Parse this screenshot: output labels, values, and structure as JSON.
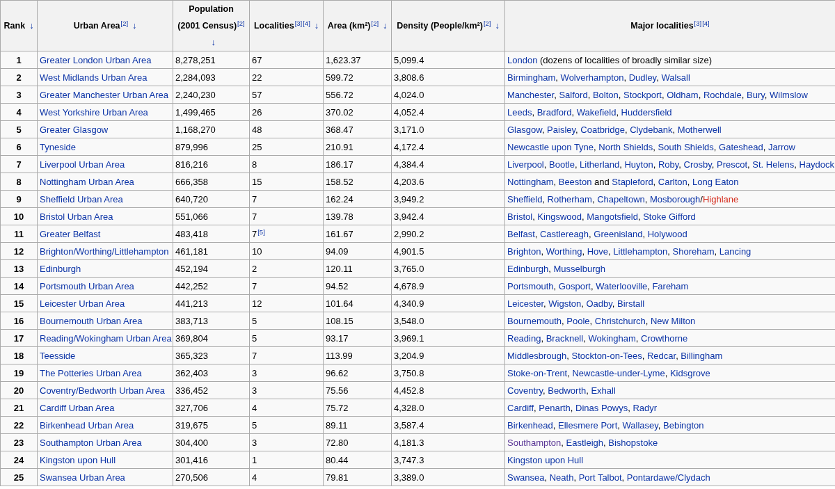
{
  "columns": [
    {
      "label": "Rank",
      "sort_icon": "↓",
      "kind": "sortable"
    },
    {
      "label": "Urban Area",
      "sort_icon": "↓",
      "refs": [
        "[2]"
      ],
      "kind": "sortable"
    },
    {
      "label": "Population",
      "label_2": "(2001 Census)",
      "sort_icon": "↓",
      "refs": [
        "[2]"
      ],
      "kind": "sortable"
    },
    {
      "label": "Localities",
      "sort_icon": "↓",
      "refs": [
        "[3]",
        "[4]"
      ],
      "kind": "sortable"
    },
    {
      "label": "Area (km²)",
      "sort_icon": "↓",
      "refs": [
        "[2]"
      ],
      "kind": "sortable"
    },
    {
      "label": "Density (People/km²)",
      "sort_icon": "↓",
      "refs": [
        "[2]"
      ],
      "kind": "sortable"
    },
    {
      "label": "Major localities",
      "refs": [
        "[3]",
        "[4]"
      ],
      "kind": "plain"
    }
  ],
  "rows": [
    {
      "rank": "1",
      "urban_area": "Greater London Urban Area",
      "population": "8,278,251",
      "localities": "67",
      "area": "1,623.37",
      "density": "5,099.4",
      "major": [
        {
          "text": "London",
          "kind": "link",
          "after": " (dozens of localities of broadly similar size)"
        }
      ]
    },
    {
      "rank": "2",
      "urban_area": "West Midlands Urban Area",
      "population": "2,284,093",
      "localities": "22",
      "area": "599.72",
      "density": "3,808.6",
      "major": [
        {
          "text": "Birmingham",
          "kind": "link",
          "after": ", "
        },
        {
          "text": "Wolverhampton",
          "kind": "link",
          "after": ", "
        },
        {
          "text": "Dudley",
          "kind": "link",
          "after": ", "
        },
        {
          "text": "Walsall",
          "kind": "link"
        }
      ]
    },
    {
      "rank": "3",
      "urban_area": "Greater Manchester Urban Area",
      "population": "2,240,230",
      "localities": "57",
      "area": "556.72",
      "density": "4,024.0",
      "major": [
        {
          "text": "Manchester",
          "kind": "link",
          "after": ", "
        },
        {
          "text": "Salford",
          "kind": "link",
          "after": ", "
        },
        {
          "text": "Bolton",
          "kind": "link",
          "after": ", "
        },
        {
          "text": "Stockport",
          "kind": "link",
          "after": ", "
        },
        {
          "text": "Oldham",
          "kind": "link",
          "after": ", "
        },
        {
          "text": "Rochdale",
          "kind": "link",
          "after": ", "
        },
        {
          "text": "Bury",
          "kind": "link",
          "after": ", "
        },
        {
          "text": "Wilmslow",
          "kind": "link"
        }
      ]
    },
    {
      "rank": "4",
      "urban_area": "West Yorkshire Urban Area",
      "population": "1,499,465",
      "localities": "26",
      "area": "370.02",
      "density": "4,052.4",
      "major": [
        {
          "text": "Leeds",
          "kind": "link",
          "after": ", "
        },
        {
          "text": "Bradford",
          "kind": "link",
          "after": ", "
        },
        {
          "text": "Wakefield",
          "kind": "link",
          "after": ", "
        },
        {
          "text": "Huddersfield",
          "kind": "link"
        }
      ]
    },
    {
      "rank": "5",
      "urban_area": "Greater Glasgow",
      "population": "1,168,270",
      "localities": "48",
      "area": "368.47",
      "density": "3,171.0",
      "major": [
        {
          "text": "Glasgow",
          "kind": "link",
          "after": ", "
        },
        {
          "text": "Paisley",
          "kind": "link",
          "after": ", "
        },
        {
          "text": "Coatbridge",
          "kind": "link",
          "after": ", "
        },
        {
          "text": "Clydebank",
          "kind": "link",
          "after": ", "
        },
        {
          "text": "Motherwell",
          "kind": "link"
        }
      ]
    },
    {
      "rank": "6",
      "urban_area": "Tyneside",
      "population": "879,996",
      "localities": "25",
      "area": "210.91",
      "density": "4,172.4",
      "major": [
        {
          "text": "Newcastle upon Tyne",
          "kind": "link",
          "after": ", "
        },
        {
          "text": "North Shields",
          "kind": "link",
          "after": ", "
        },
        {
          "text": "South Shields",
          "kind": "link",
          "after": ", "
        },
        {
          "text": "Gateshead",
          "kind": "link",
          "after": ", "
        },
        {
          "text": "Jarrow",
          "kind": "link"
        }
      ]
    },
    {
      "rank": "7",
      "urban_area": "Liverpool Urban Area",
      "population": "816,216",
      "localities": "8",
      "area": "186.17",
      "density": "4,384.4",
      "major": [
        {
          "text": "Liverpool",
          "kind": "link",
          "after": ", "
        },
        {
          "text": "Bootle",
          "kind": "link",
          "after": ", "
        },
        {
          "text": "Litherland",
          "kind": "link",
          "after": ", "
        },
        {
          "text": "Huyton",
          "kind": "link",
          "after": ", "
        },
        {
          "text": "Roby",
          "kind": "link",
          "after": ", "
        },
        {
          "text": "Crosby",
          "kind": "link",
          "after": ", "
        },
        {
          "text": "Prescot",
          "kind": "link",
          "after": ", "
        },
        {
          "text": "St. Helens",
          "kind": "link",
          "after": ", "
        },
        {
          "text": "Haydock",
          "kind": "link"
        }
      ]
    },
    {
      "rank": "8",
      "urban_area": "Nottingham Urban Area",
      "population": "666,358",
      "localities": "15",
      "area": "158.52",
      "density": "4,203.6",
      "major": [
        {
          "text": "Nottingham",
          "kind": "link",
          "after": ", "
        },
        {
          "text": "Beeston",
          "kind": "link",
          "after": " and "
        },
        {
          "text": "Stapleford",
          "kind": "link",
          "after": ", "
        },
        {
          "text": "Carlton",
          "kind": "link",
          "after": ", "
        },
        {
          "text": "Long Eaton",
          "kind": "link"
        }
      ]
    },
    {
      "rank": "9",
      "urban_area": "Sheffield Urban Area",
      "population": "640,720",
      "localities": "7",
      "area": "162.24",
      "density": "3,949.2",
      "major": [
        {
          "text": "Sheffield",
          "kind": "link",
          "after": ", "
        },
        {
          "text": "Rotherham",
          "kind": "link",
          "after": ", "
        },
        {
          "text": "Chapeltown",
          "kind": "link",
          "after": ", "
        },
        {
          "text": "Mosborough",
          "kind": "link",
          "after": "/"
        },
        {
          "text": "Highlane",
          "kind": "redlink"
        }
      ]
    },
    {
      "rank": "10",
      "urban_area": "Bristol Urban Area",
      "population": "551,066",
      "localities": "7",
      "area": "139.78",
      "density": "3,942.4",
      "major": [
        {
          "text": "Bristol",
          "kind": "link",
          "after": ", "
        },
        {
          "text": "Kingswood",
          "kind": "link",
          "after": ", "
        },
        {
          "text": "Mangotsfield",
          "kind": "link",
          "after": ", "
        },
        {
          "text": "Stoke Gifford",
          "kind": "link"
        }
      ]
    },
    {
      "rank": "11",
      "urban_area": "Greater Belfast",
      "population": "483,418",
      "localities": "7",
      "localities_ref": "[5]",
      "area": "161.67",
      "density": "2,990.2",
      "major": [
        {
          "text": "Belfast",
          "kind": "link",
          "after": ", "
        },
        {
          "text": "Castlereagh",
          "kind": "link",
          "after": ", "
        },
        {
          "text": "Greenisland",
          "kind": "link",
          "after": ", "
        },
        {
          "text": "Holywood",
          "kind": "link"
        }
      ]
    },
    {
      "rank": "12",
      "urban_area": "Brighton/Worthing/Littlehampton",
      "population": "461,181",
      "localities": "10",
      "area": "94.09",
      "density": "4,901.5",
      "major": [
        {
          "text": "Brighton",
          "kind": "link",
          "after": ", "
        },
        {
          "text": "Worthing",
          "kind": "link",
          "after": ", "
        },
        {
          "text": "Hove",
          "kind": "link",
          "after": ", "
        },
        {
          "text": "Littlehampton",
          "kind": "link",
          "after": ", "
        },
        {
          "text": "Shoreham",
          "kind": "link",
          "after": ", "
        },
        {
          "text": "Lancing",
          "kind": "link"
        }
      ]
    },
    {
      "rank": "13",
      "urban_area": "Edinburgh",
      "population": "452,194",
      "localities": "2",
      "area": "120.11",
      "density": "3,765.0",
      "major": [
        {
          "text": "Edinburgh",
          "kind": "link",
          "after": ", "
        },
        {
          "text": "Musselburgh",
          "kind": "link"
        }
      ]
    },
    {
      "rank": "14",
      "urban_area": "Portsmouth Urban Area",
      "population": "442,252",
      "localities": "7",
      "area": "94.52",
      "density": "4,678.9",
      "major": [
        {
          "text": "Portsmouth",
          "kind": "link",
          "after": ", "
        },
        {
          "text": "Gosport",
          "kind": "link",
          "after": ", "
        },
        {
          "text": "Waterlooville",
          "kind": "link",
          "after": ", "
        },
        {
          "text": "Fareham",
          "kind": "link"
        }
      ]
    },
    {
      "rank": "15",
      "urban_area": "Leicester Urban Area",
      "population": "441,213",
      "localities": "12",
      "area": "101.64",
      "density": "4,340.9",
      "major": [
        {
          "text": "Leicester",
          "kind": "link",
          "after": ", "
        },
        {
          "text": "Wigston",
          "kind": "link",
          "after": ", "
        },
        {
          "text": "Oadby",
          "kind": "link",
          "after": ", "
        },
        {
          "text": "Birstall",
          "kind": "link"
        }
      ]
    },
    {
      "rank": "16",
      "urban_area": "Bournemouth Urban Area",
      "population": "383,713",
      "localities": "5",
      "area": "108.15",
      "density": "3,548.0",
      "major": [
        {
          "text": "Bournemouth",
          "kind": "link",
          "after": ", "
        },
        {
          "text": "Poole",
          "kind": "link",
          "after": ", "
        },
        {
          "text": "Christchurch",
          "kind": "link",
          "after": ", "
        },
        {
          "text": "New Milton",
          "kind": "link"
        }
      ]
    },
    {
      "rank": "17",
      "urban_area": "Reading/Wokingham Urban Area",
      "population": "369,804",
      "localities": "5",
      "area": "93.17",
      "density": "3,969.1",
      "major": [
        {
          "text": "Reading",
          "kind": "link",
          "after": ", "
        },
        {
          "text": "Bracknell",
          "kind": "link",
          "after": ", "
        },
        {
          "text": "Wokingham",
          "kind": "link",
          "after": ", "
        },
        {
          "text": "Crowthorne",
          "kind": "link"
        }
      ]
    },
    {
      "rank": "18",
      "urban_area": "Teesside",
      "population": "365,323",
      "localities": "7",
      "area": "113.99",
      "density": "3,204.9",
      "major": [
        {
          "text": "Middlesbrough",
          "kind": "link",
          "after": ", "
        },
        {
          "text": "Stockton-on-Tees",
          "kind": "link",
          "after": ", "
        },
        {
          "text": "Redcar",
          "kind": "link",
          "after": ", "
        },
        {
          "text": "Billingham",
          "kind": "link"
        }
      ]
    },
    {
      "rank": "19",
      "urban_area": "The Potteries Urban Area",
      "population": "362,403",
      "localities": "3",
      "area": "96.62",
      "density": "3,750.8",
      "major": [
        {
          "text": "Stoke-on-Trent",
          "kind": "link",
          "after": ", "
        },
        {
          "text": "Newcastle-under-Lyme",
          "kind": "link",
          "after": ", "
        },
        {
          "text": "Kidsgrove",
          "kind": "link"
        }
      ]
    },
    {
      "rank": "20",
      "urban_area": "Coventry/Bedworth Urban Area",
      "population": "336,452",
      "localities": "3",
      "area": "75.56",
      "density": "4,452.8",
      "major": [
        {
          "text": "Coventry",
          "kind": "link",
          "after": ", "
        },
        {
          "text": "Bedworth",
          "kind": "link",
          "after": ", "
        },
        {
          "text": "Exhall",
          "kind": "link"
        }
      ]
    },
    {
      "rank": "21",
      "urban_area": "Cardiff Urban Area",
      "population": "327,706",
      "localities": "4",
      "area": "75.72",
      "density": "4,328.0",
      "major": [
        {
          "text": "Cardiff",
          "kind": "link",
          "after": ", "
        },
        {
          "text": "Penarth",
          "kind": "link",
          "after": ", "
        },
        {
          "text": "Dinas Powys",
          "kind": "link",
          "after": ", "
        },
        {
          "text": "Radyr",
          "kind": "link"
        }
      ]
    },
    {
      "rank": "22",
      "urban_area": "Birkenhead Urban Area",
      "population": "319,675",
      "localities": "5",
      "area": "89.11",
      "density": "3,587.4",
      "major": [
        {
          "text": "Birkenhead",
          "kind": "link",
          "after": ", "
        },
        {
          "text": "Ellesmere Port",
          "kind": "link",
          "after": ", "
        },
        {
          "text": "Wallasey",
          "kind": "link",
          "after": ", "
        },
        {
          "text": "Bebington",
          "kind": "link"
        }
      ]
    },
    {
      "rank": "23",
      "urban_area": "Southampton Urban Area",
      "population": "304,400",
      "localities": "3",
      "area": "72.80",
      "density": "4,181.3",
      "major": [
        {
          "text": "Southampton",
          "kind": "visited",
          "after": ", "
        },
        {
          "text": "Eastleigh",
          "kind": "link",
          "after": ", "
        },
        {
          "text": "Bishopstoke",
          "kind": "link"
        }
      ]
    },
    {
      "rank": "24",
      "urban_area": "Kingston upon Hull",
      "population": "301,416",
      "localities": "1",
      "area": "80.44",
      "density": "3,747.3",
      "major": [
        {
          "text": "Kingston upon Hull",
          "kind": "link"
        }
      ]
    },
    {
      "rank": "25",
      "urban_area": "Swansea Urban Area",
      "population": "270,506",
      "localities": "4",
      "area": "79.81",
      "density": "3,389.0",
      "major": [
        {
          "text": "Swansea",
          "kind": "link",
          "after": ", "
        },
        {
          "text": "Neath",
          "kind": "link",
          "after": ", "
        },
        {
          "text": "Port Talbot",
          "kind": "link",
          "after": ", "
        },
        {
          "text": "Pontardawe/Clydach",
          "kind": "link"
        }
      ]
    }
  ]
}
